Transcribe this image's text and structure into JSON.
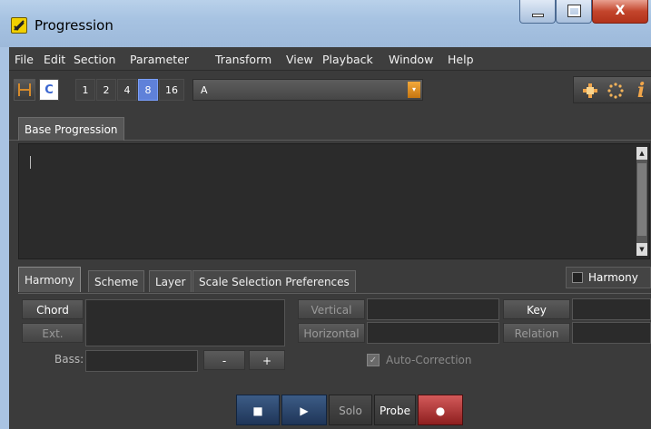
{
  "window": {
    "title": "Progression",
    "controls": {
      "minimize": "_",
      "maximize": "□",
      "close": "X"
    }
  },
  "menubar": {
    "items": [
      "File",
      "Edit",
      "Section",
      "Parameter",
      "Transform",
      "View",
      "Playback",
      "Window",
      "Help"
    ]
  },
  "toolbar": {
    "mode_icon": "bracket-icon",
    "chord_letter": "C",
    "divisions": [
      "1",
      "2",
      "4",
      "8",
      "16"
    ],
    "selected_division": "8",
    "key_value": "A",
    "dropdown_arrow": "▾",
    "right_icons": [
      "move-icon",
      "sparkle-icon",
      "info-icon"
    ],
    "colors": {
      "active": "#5f81d9",
      "accent": "#f3a93b"
    }
  },
  "tabs": {
    "main": [
      "Base Progression"
    ]
  },
  "editor": {
    "text": ""
  },
  "lower_panel": {
    "tabs": [
      "Harmony",
      "Scheme",
      "Layer",
      "Scale Selection Preferences"
    ],
    "active_tab": "Harmony",
    "harmony_toggle": "Harmony",
    "chord_label": "Chord",
    "ext_label": "Ext.",
    "bass_label": "Bass:",
    "minus_label": "-",
    "plus_label": "+",
    "vertical_label": "Vertical",
    "horizontal_label": "Horizontal",
    "key_label": "Key",
    "relation_label": "Relation",
    "autocorrection_label": "Auto-Correction",
    "autocorrection_checked": true
  },
  "transport": {
    "stop_icon": "■",
    "play_icon": "▶",
    "solo": "Solo",
    "probe": "Probe",
    "record_icon": "●"
  }
}
